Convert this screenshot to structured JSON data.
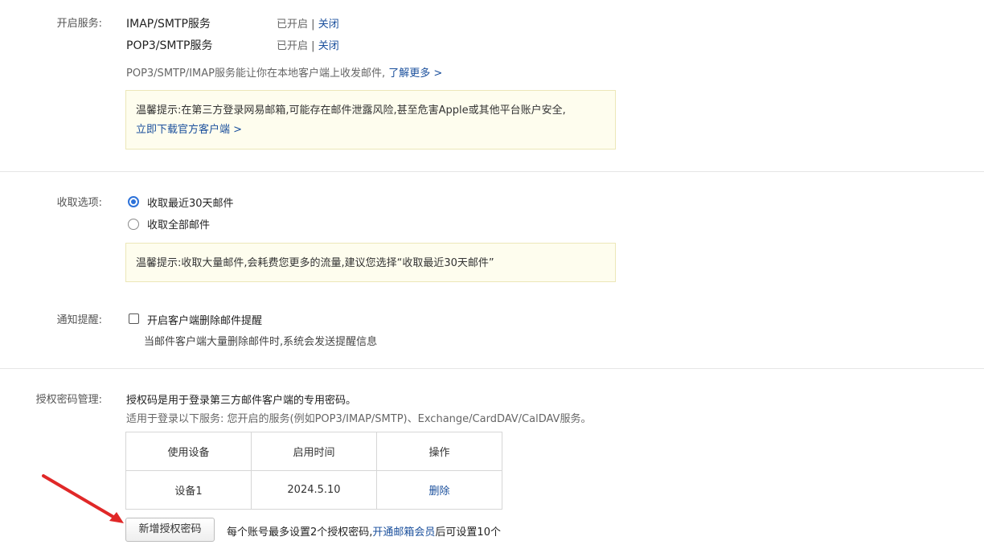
{
  "services": {
    "label": "开启服务:",
    "items": [
      {
        "name": "IMAP/SMTP服务",
        "status": "已开启",
        "separator": "|",
        "action": "关闭"
      },
      {
        "name": "POP3/SMTP服务",
        "status": "已开启",
        "separator": "|",
        "action": "关闭"
      }
    ],
    "description": "POP3/SMTP/IMAP服务能让你在本地客户端上收发邮件,",
    "learn_more": "了解更多 >",
    "tip_text": "温馨提示:在第三方登录网易邮箱,可能存在邮件泄露风险,甚至危害Apple或其他平台账户安全,",
    "tip_link": "立即下载官方客户端 >"
  },
  "receive": {
    "label": "收取选项:",
    "options": [
      {
        "label": "收取最近30天邮件",
        "selected": true
      },
      {
        "label": "收取全部邮件",
        "selected": false
      }
    ],
    "tip_text": "温馨提示:收取大量邮件,会耗费您更多的流量,建议您选择“收取最近30天邮件”"
  },
  "notify": {
    "label": "通知提醒:",
    "checkbox_label": "开启客户端删除邮件提醒",
    "checked": false,
    "description": "当邮件客户端大量删除邮件时,系统会发送提醒信息"
  },
  "auth": {
    "label": "授权密码管理:",
    "heading": "授权码是用于登录第三方邮件客户端的专用密码。",
    "subheading": "适用于登录以下服务: 您开启的服务(例如POP3/IMAP/SMTP)、Exchange/CardDAV/CalDAV服务。",
    "table": {
      "headers": [
        "使用设备",
        "启用时间",
        "操作"
      ],
      "rows": [
        {
          "device": "设备1",
          "date": "2024.5.10",
          "action": "删除"
        }
      ]
    },
    "add_button": "新增授权密码",
    "limit_text_before": "每个账号最多设置2个授权密码,",
    "limit_link": "开通邮箱会员",
    "limit_text_after": "后可设置10个"
  },
  "colors": {
    "link": "#1a4f9c",
    "radio_accent": "#2d72d9",
    "tip_background": "#fefdee",
    "annotation_arrow": "#e02828"
  }
}
